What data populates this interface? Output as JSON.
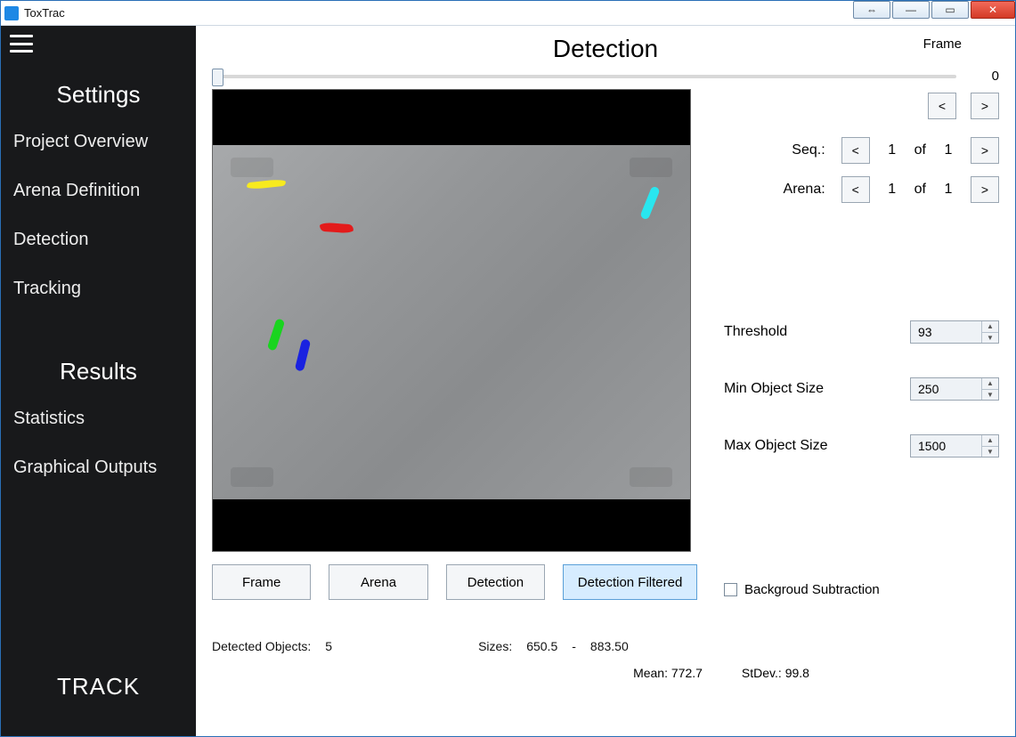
{
  "window": {
    "title": "ToxTrac"
  },
  "sidebar": {
    "settings_header": "Settings",
    "items": [
      {
        "label": "Project Overview"
      },
      {
        "label": "Arena Definition"
      },
      {
        "label": "Detection"
      },
      {
        "label": "Tracking"
      }
    ],
    "results_header": "Results",
    "results_items": [
      {
        "label": "Statistics"
      },
      {
        "label": "Graphical Outputs"
      }
    ],
    "track_label": "TRACK"
  },
  "page": {
    "title": "Detection",
    "frame_label": "Frame",
    "frame_value": "0"
  },
  "nav": {
    "prev": "<",
    "next": ">",
    "seq_label": "Seq.:",
    "arena_label": "Arena:",
    "of": "of",
    "seq_cur": "1",
    "seq_tot": "1",
    "arena_cur": "1",
    "arena_tot": "1"
  },
  "params": {
    "threshold_label": "Threshold",
    "threshold_value": "93",
    "minsize_label": "Min Object Size",
    "minsize_value": "250",
    "maxsize_label": "Max Object Size",
    "maxsize_value": "1500",
    "bgsub_label": "Backgroud Subtraction"
  },
  "viewmodes": {
    "frame": "Frame",
    "arena": "Arena",
    "detection": "Detection",
    "filtered": "Detection Filtered"
  },
  "stats": {
    "detected_label": "Detected Objects:",
    "detected_value": "5",
    "sizes_label": "Sizes:",
    "sizes_min": "650.5",
    "sizes_sep": "-",
    "sizes_max": "883.50",
    "mean_label": "Mean:",
    "mean_value": "772.7",
    "stdev_label": "StDev.:",
    "stdev_value": "99.8"
  }
}
